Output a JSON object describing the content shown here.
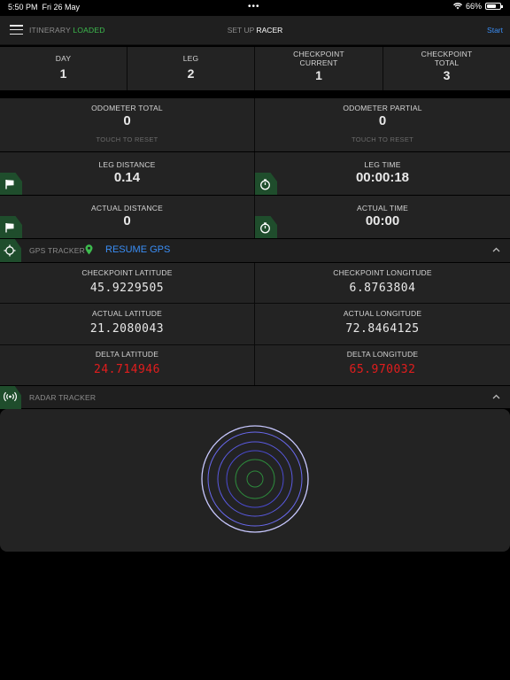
{
  "status": {
    "time": "5:50 PM",
    "date": "Fri 26 May",
    "dots": "•••",
    "battery": "66%"
  },
  "nav": {
    "itinerary_label": "ITINERARY",
    "itinerary_state": "LOADED",
    "setup_label": "SET UP",
    "setup_mode": "RACER",
    "start_label": "Start"
  },
  "top": [
    {
      "label": "DAY",
      "value": "1"
    },
    {
      "label": "LEG",
      "value": "2"
    },
    {
      "label": "CHECKPOINT\nCURRENT",
      "value": "1"
    },
    {
      "label": "CHECKPOINT\nTOTAL",
      "value": "3"
    }
  ],
  "odometer": {
    "total_label": "ODOMETER TOTAL",
    "total_value": "0",
    "partial_label": "ODOMETER PARTIAL",
    "partial_value": "0",
    "reset_hint": "TOUCH TO RESET"
  },
  "leg": {
    "distance_label": "LEG DISTANCE",
    "distance_value": "0.14",
    "time_label": "LEG TIME",
    "time_value": "00:00:18"
  },
  "actual": {
    "distance_label": "ACTUAL DISTANCE",
    "distance_value": "0",
    "time_label": "ACTUAL TIME",
    "time_value": "00:00"
  },
  "gps": {
    "title": "GPS TRACKER",
    "resume_label": "RESUME GPS",
    "cp_lat_label": "CHECKPOINT LATITUDE",
    "cp_lat_value": "45.9229505",
    "cp_lon_label": "CHECKPOINT LONGITUDE",
    "cp_lon_value": "6.8763804",
    "act_lat_label": "ACTUAL LATITUDE",
    "act_lat_value": "21.2080043",
    "act_lon_label": "ACTUAL LONGITUDE",
    "act_lon_value": "72.8464125",
    "d_lat_label": "DELTA LATITUDE",
    "d_lat_value": "24.714946",
    "d_lon_label": "DELTA LONGITUDE",
    "d_lon_value": "65.970032"
  },
  "radar": {
    "title": "RADAR TRACKER"
  },
  "icons": {
    "menu": "hamburger-icon",
    "flag": "flag-icon",
    "stopwatch": "stopwatch-icon",
    "crosshair": "crosshair-icon",
    "pin": "map-pin-icon",
    "radar": "radar-waves-icon",
    "chevron": "chevron-up-icon"
  },
  "colors": {
    "accent_green": "#3dbb4e",
    "link_blue": "#3a8ef6",
    "delta_red": "#e21d1d",
    "tag_green": "#1f4d2c"
  }
}
